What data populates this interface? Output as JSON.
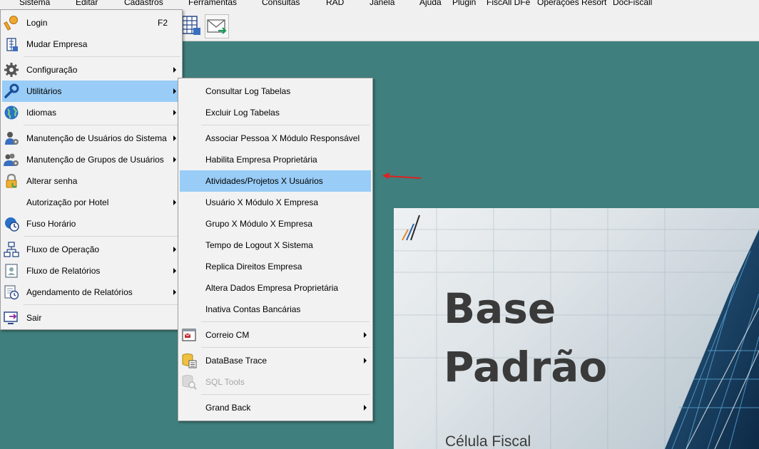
{
  "menubar": [
    "Sistema",
    "Editar",
    "Cadastros",
    "Ferramentas",
    "Consultas",
    "RAD",
    "Janela",
    "Ajuda",
    "Plugin",
    "FiscAll DFe",
    "Operações Resort",
    "DocFiscall"
  ],
  "toolbar": {
    "buttons": [
      "grid-icon",
      "mail-icon"
    ]
  },
  "sistema_menu": {
    "items": [
      {
        "label": "Login",
        "shortcut": "F2",
        "icon": "key-icon"
      },
      {
        "label": "Mudar Empresa",
        "icon": "building-icon"
      },
      {
        "label": "Configuração",
        "icon": "gear-icon",
        "submenu": true
      },
      {
        "label": "Utilitários",
        "icon": "wrench-icon",
        "submenu": true,
        "highlighted": true
      },
      {
        "label": "Idiomas",
        "icon": "globe-icon",
        "submenu": true
      },
      {
        "label": "Manutenção de Usuários do Sistema",
        "icon": "user-gear-icon",
        "submenu": true
      },
      {
        "label": "Manutenção de Grupos de Usuários",
        "icon": "users-gear-icon",
        "submenu": true
      },
      {
        "label": "Alterar senha",
        "icon": "padlock-icon"
      },
      {
        "label": "Autorização por Hotel",
        "submenu": true
      },
      {
        "label": "Fuso Horário",
        "icon": "globe-clock-icon"
      },
      {
        "label": "Fluxo de Operação",
        "icon": "flowchart-icon",
        "submenu": true
      },
      {
        "label": "Fluxo de Relatórios",
        "icon": "report-flow-icon",
        "submenu": true
      },
      {
        "label": "Agendamento de Relatórios",
        "icon": "report-clock-icon",
        "submenu": true
      },
      {
        "label": "Sair",
        "icon": "exit-icon"
      }
    ]
  },
  "utilitarios_menu": {
    "items": [
      {
        "label": "Consultar Log Tabelas"
      },
      {
        "label": "Excluir Log Tabelas"
      },
      {
        "label": "Associar Pessoa X Módulo Responsável"
      },
      {
        "label": "Habilita Empresa Proprietária"
      },
      {
        "label": "Atividades/Projetos X Usuários",
        "highlighted": true
      },
      {
        "label": "Usuário X Módulo X Empresa"
      },
      {
        "label": "Grupo X Módulo X Empresa"
      },
      {
        "label": "Tempo de Logout X Sistema"
      },
      {
        "label": "Replica Direitos Empresa"
      },
      {
        "label": "Altera Dados Empresa Proprietária"
      },
      {
        "label": "Inativa Contas Bancárias"
      },
      {
        "label": "Correio CM",
        "icon": "mail-window-icon",
        "submenu": true
      },
      {
        "label": "DataBase Trace",
        "icon": "database-icon",
        "submenu": true
      },
      {
        "label": "SQL Tools",
        "icon": "db-search-icon",
        "disabled": true
      },
      {
        "label": "Grand Back",
        "submenu": true
      }
    ]
  },
  "banner": {
    "title_line1": "Base",
    "title_line2": "Padrão",
    "subtitle": "Célula Fiscal"
  },
  "colors": {
    "desktop": "#3f7f7d",
    "highlight": "#99ccf6",
    "menu_bg": "#f2f2f2",
    "annotation_arrow": "#e02020"
  }
}
